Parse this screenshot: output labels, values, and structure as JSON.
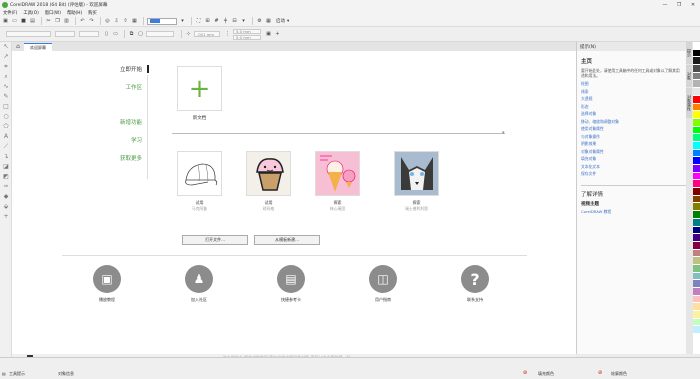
{
  "window": {
    "title": "CorelDRAW 2018 (64 Bit) (评估版) - 欢迎屏幕",
    "minimize": "—",
    "maximize": "❐",
    "close": "✕"
  },
  "menu": [
    "文件(F)",
    "工具(O)",
    "窗口(W)",
    "帮助(H)",
    "购买"
  ],
  "toolbar": {
    "zoom_value": "",
    "launch_label": "启动",
    "launch_arrow": "▾"
  },
  "toolbar2": {
    "field1": "",
    "field2": "",
    "field3": ".001 mm",
    "field4": "5.0 mm",
    "field5": "5.0 mm"
  },
  "tabs": {
    "home_icon": "home-icon",
    "welcome": "欢迎屏幕"
  },
  "nav": {
    "items": [
      "立即开始",
      "工作区",
      "新增功能",
      "学习",
      "获取更多"
    ],
    "selected": "立即开始"
  },
  "newdoc": {
    "label": "新文档"
  },
  "recent_cards": [
    {
      "title": "试用",
      "sub": "马克阿鲁"
    },
    {
      "title": "试用",
      "sub": "琼玛格"
    },
    {
      "title": "探索",
      "sub": "林心瑶团"
    },
    {
      "title": "探索",
      "sub": "瑞士普利利恩"
    }
  ],
  "buttons": {
    "open": "打开文件...",
    "template": "从模板新建..."
  },
  "resources": [
    {
      "label": "播放教程",
      "icon": "monitor-icon",
      "glyph": "▣"
    },
    {
      "label": "加入社区",
      "icon": "community-icon",
      "glyph": "♟"
    },
    {
      "label": "快捷参考卡",
      "icon": "reference-card-icon",
      "glyph": "▤"
    },
    {
      "label": "用户指南",
      "icon": "user-guide-icon",
      "glyph": "◫"
    },
    {
      "label": "联系支持",
      "icon": "help-icon",
      "glyph": "?"
    }
  ],
  "status_hint": "单击时单击  将此对象移回  您在文档中保留的对象 直接从中主要效果一起",
  "docker": {
    "header": "提示(N)",
    "title": "主页",
    "intro": "要开始此处，请使用工具箱中的任何工具或对象以了解其用途和用法。",
    "links": [
      "绘图",
      "线条",
      "大透视",
      "形态",
      "选择对象",
      "移动、缩放和调整对象",
      "使用对象属性",
      "与对象操作",
      "阴影效果",
      "对象对象属性",
      "填充对象",
      "文本化文本",
      "保存文件"
    ],
    "learn_title": "了解详情",
    "learn_sub": "视频主题",
    "learn_link": "CorelDRAW 教程"
  },
  "docker_tabs": [
    "提示",
    "对象",
    "对象属性"
  ],
  "palette_colors": [
    "#ffffff",
    "#000000",
    "#1a1a1a",
    "#4d4d4d",
    "#808080",
    "#b3b3b3",
    "#e6e6e6",
    "#ff0000",
    "#ff8000",
    "#ffff00",
    "#80ff00",
    "#00ff00",
    "#00ff80",
    "#00ffff",
    "#0080ff",
    "#0000ff",
    "#8000ff",
    "#ff00ff",
    "#ff0080",
    "#800000",
    "#804000",
    "#808000",
    "#008000",
    "#008080",
    "#000080",
    "#400080",
    "#800040",
    "#c08080",
    "#c0c080",
    "#80c080",
    "#80c0c0",
    "#8080c0",
    "#c080c0",
    "#ffc0c0",
    "#ffe0a0",
    "#fff0a0",
    "#c0ffc0",
    "#c0f0ff"
  ],
  "statusbar": {
    "left": "工具提示",
    "object_info": "对象信息",
    "fill": "填充颜色",
    "outline": "轮廓颜色"
  }
}
